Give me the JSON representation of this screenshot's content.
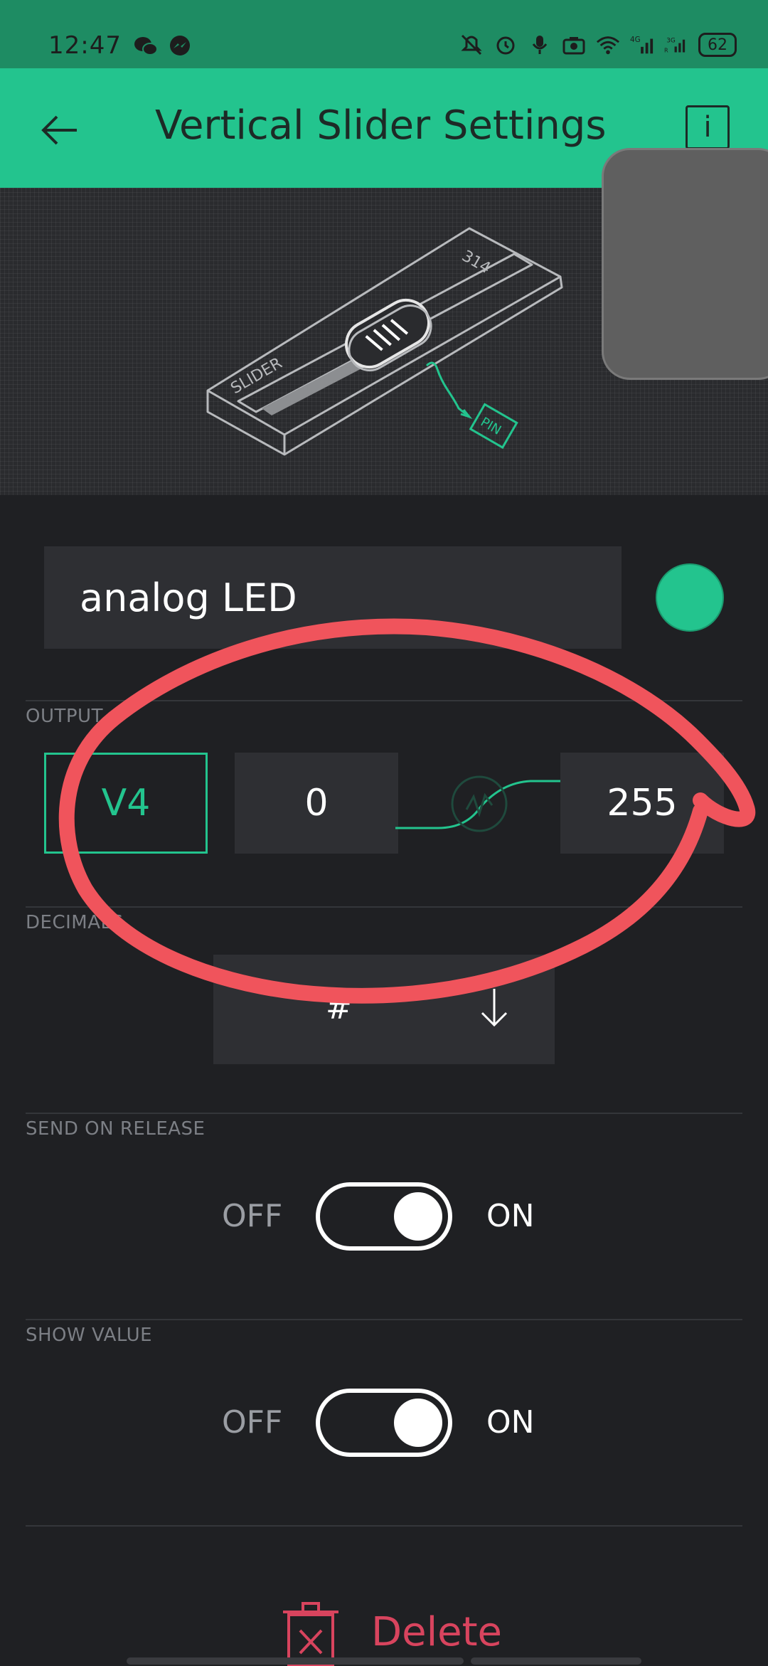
{
  "status_bar": {
    "time": "12:47",
    "battery": "62",
    "icons_left": [
      "wechat-icon",
      "messenger-icon"
    ],
    "icons_right": [
      "mute-icon",
      "alarm-icon",
      "mic-icon",
      "camera-icon",
      "wifi-icon",
      "signal-4g-icon",
      "signal-3g-icon"
    ]
  },
  "app_bar": {
    "title": "Vertical Slider Settings",
    "back_icon": "arrow-left-icon",
    "info_label": "i",
    "accent": "#23c48e"
  },
  "preview": {
    "slider_label": "SLIDER",
    "slider_number": "314",
    "pin_label": "PIN"
  },
  "widget": {
    "name": "analog LED",
    "color": "#23c48e"
  },
  "output": {
    "section_label": "OUTPUT",
    "pin": "V4",
    "min": "0",
    "max": "255"
  },
  "decimals": {
    "section_label": "DECIMALS",
    "value": "#"
  },
  "send_on_release": {
    "section_label": "SEND ON RELEASE",
    "off_label": "OFF",
    "on_label": "ON",
    "state": "on"
  },
  "show_value": {
    "section_label": "SHOW VALUE",
    "off_label": "OFF",
    "on_label": "ON",
    "state": "on"
  },
  "delete": {
    "label": "Delete",
    "color": "#d8445e"
  },
  "annotation_color": "#f0545c"
}
